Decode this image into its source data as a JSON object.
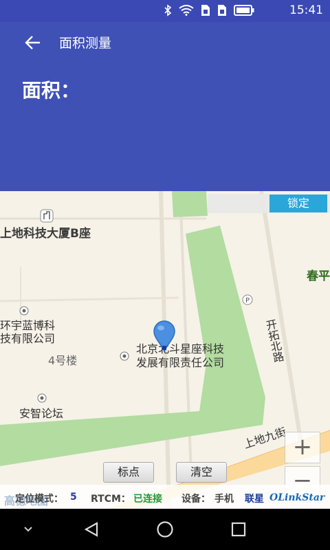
{
  "status_bar": {
    "time": "15:41",
    "icons": [
      "bluetooth-icon",
      "wifi-icon",
      "sim1-icon",
      "sim2-icon",
      "battery-icon"
    ]
  },
  "app_bar": {
    "title": "面积测量",
    "area_label": "面积："
  },
  "map": {
    "lock_label": "锁定",
    "labels": {
      "building_b": "上地科技大厦B座",
      "lanbo_1": "环宇蓝博科",
      "lanbo_2": "技有限公司",
      "building4": "4号楼",
      "beidou_1": "北京北斗星座科技",
      "beidou_2": "发展有限责任公司",
      "anzhi": "安智论坛",
      "kaituo": "开拓北路",
      "jiujie": "上地九街",
      "chunping": "春平",
      "amap": "高德地图"
    },
    "zoom_in": "+",
    "zoom_out": "−",
    "mark_button": "标点",
    "clear_button": "清空"
  },
  "info_bar": {
    "mode_label": "定位模式：",
    "mode_value": "5",
    "rtcm_label": "RTCM：",
    "rtcm_value": "已连接",
    "device_label": "设备：",
    "device_value": "手机",
    "brand_cn": "联星",
    "brand_en": "OLinkStar"
  },
  "colors": {
    "primary": "#3f51b5",
    "accent": "#2aa6d9",
    "connected": "#1e9a3a",
    "map_green": "#b3dca0"
  }
}
